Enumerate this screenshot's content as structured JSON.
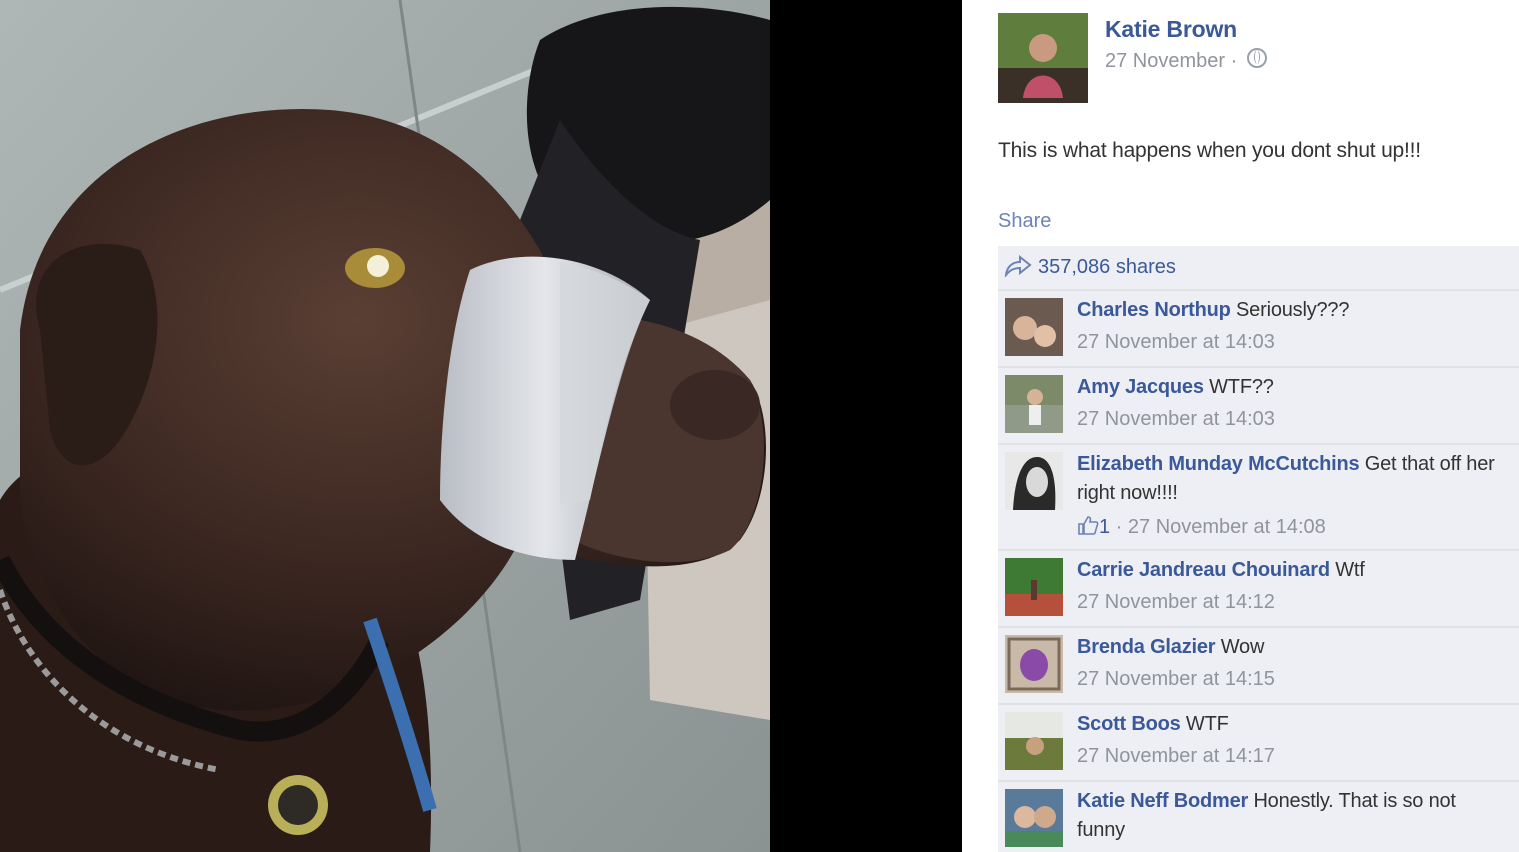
{
  "post": {
    "author": "Katie Brown",
    "date": "27 November",
    "separator": " · ",
    "text": "This is what happens when you dont shut up!!!",
    "share_label": "Share",
    "shares": "357,086 shares"
  },
  "comments": [
    {
      "name": "Charles Northup",
      "text": "Seriously???",
      "time": "27 November at 14:03"
    },
    {
      "name": "Amy Jacques",
      "text": "WTF??",
      "time": "27 November at 14:03"
    },
    {
      "name": "Elizabeth Munday McCutchins",
      "text": "Get that off her",
      "text2": "right now!!!!",
      "likes": "1",
      "time_prefix": " · ",
      "time": "27 November at 14:08"
    },
    {
      "name": "Carrie Jandreau Chouinard",
      "text": "Wtf",
      "time": "27 November at 14:12"
    },
    {
      "name": "Brenda Glazier",
      "text": "Wow",
      "time": "27 November at 14:15"
    },
    {
      "name": "Scott Boos",
      "text": "WTF",
      "time": "27 November at 14:17"
    },
    {
      "name": "Katie Neff Bodmer",
      "text": "Honestly. That is so not",
      "text2": "funny"
    }
  ],
  "icons": {
    "privacy": "globe-icon",
    "shares": "share-arrow-icon",
    "like": "thumbs-up-icon"
  },
  "colors": {
    "link": "#3b5998",
    "meta": "#90949c",
    "comment_bg": "#edeff4",
    "text": "#333333"
  }
}
